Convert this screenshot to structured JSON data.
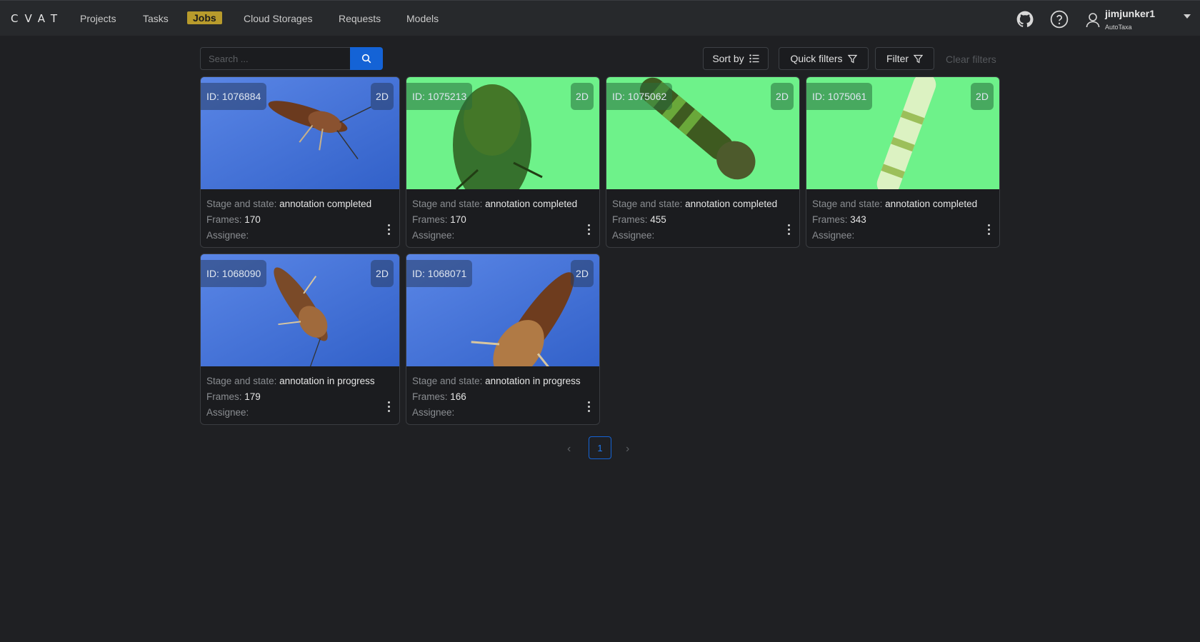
{
  "header": {
    "logo": "CVAT",
    "nav": [
      {
        "label": "Projects"
      },
      {
        "label": "Tasks"
      },
      {
        "label": "Jobs"
      },
      {
        "label": "Cloud Storages"
      },
      {
        "label": "Requests"
      },
      {
        "label": "Models"
      }
    ],
    "active_nav": "Jobs",
    "user": {
      "name": "jimjunker1",
      "organization": "AutoTaxa"
    },
    "icons": [
      "github-icon",
      "help-icon",
      "user-icon",
      "caret-down-icon"
    ]
  },
  "toolbar": {
    "search_placeholder": "Search ...",
    "sort_label": "Sort by",
    "quick_filters_label": "Quick filters",
    "filter_label": "Filter",
    "clear_filters_label": "Clear filters"
  },
  "labels": {
    "stage": "Stage and state",
    "frames": "Frames",
    "assignee": "Assignee"
  },
  "jobs": [
    {
      "id_text": "ID: 1076884",
      "dimension": "2D",
      "state": "annotation completed",
      "frames": "170",
      "assignee": "",
      "thumbnail": "blue"
    },
    {
      "id_text": "ID: 1075213",
      "dimension": "2D",
      "state": "annotation completed",
      "frames": "170",
      "assignee": "",
      "thumbnail": "green"
    },
    {
      "id_text": "ID: 1075062",
      "dimension": "2D",
      "state": "annotation completed",
      "frames": "455",
      "assignee": "",
      "thumbnail": "green"
    },
    {
      "id_text": "ID: 1075061",
      "dimension": "2D",
      "state": "annotation completed",
      "frames": "343",
      "assignee": "",
      "thumbnail": "green"
    },
    {
      "id_text": "ID: 1068090",
      "dimension": "2D",
      "state": "annotation in progress",
      "frames": "179",
      "assignee": "",
      "thumbnail": "blue"
    },
    {
      "id_text": "ID: 1068071",
      "dimension": "2D",
      "state": "annotation in progress",
      "frames": "166",
      "assignee": "",
      "thumbnail": "blue"
    }
  ],
  "pagination": {
    "current_page": "1",
    "prev_glyph": "‹",
    "next_glyph": "›"
  },
  "colors": {
    "accent": "#1463d6",
    "active_nav": "#b89b2c",
    "background": "#1f2023"
  }
}
